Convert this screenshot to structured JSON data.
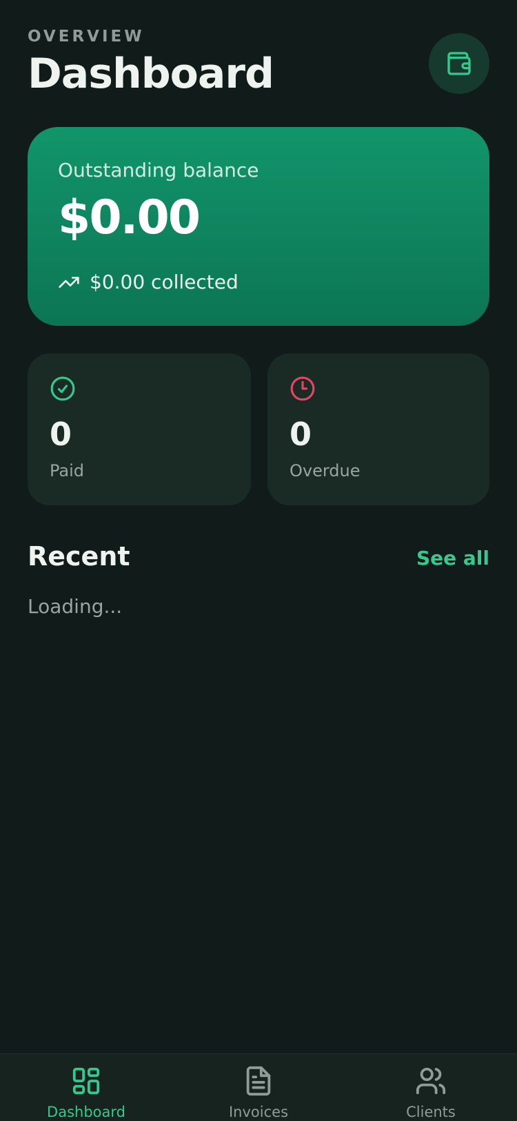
{
  "header": {
    "eyebrow": "OVERVIEW",
    "title": "Dashboard",
    "action_icon": "wallet-icon"
  },
  "balance": {
    "label": "Outstanding balance",
    "amount": "$0.00",
    "collected": "$0.00 collected",
    "trend_icon": "trending-up-icon"
  },
  "stats": {
    "paid": {
      "value": "0",
      "label": "Paid",
      "icon": "check-circle-icon",
      "color": "#34c98e"
    },
    "overdue": {
      "value": "0",
      "label": "Overdue",
      "icon": "clock-icon",
      "color": "#e2475f"
    }
  },
  "recent": {
    "title": "Recent",
    "see_all": "See all",
    "status": "Loading..."
  },
  "tabs": [
    {
      "label": "Dashboard",
      "icon": "dashboard-grid-icon",
      "active": true
    },
    {
      "label": "Invoices",
      "icon": "document-icon",
      "active": false
    },
    {
      "label": "Clients",
      "icon": "users-icon",
      "active": false
    }
  ],
  "colors": {
    "background": "#111b19",
    "accent": "#34c98e",
    "card": "#1a2b25",
    "balance_gradient_top": "#12956a",
    "balance_gradient_bottom": "#0c7553",
    "danger": "#e2475f"
  }
}
